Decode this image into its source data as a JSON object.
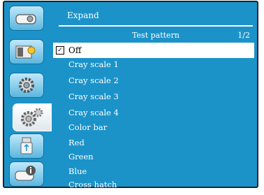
{
  "menu": {
    "title": "Expand",
    "subtitle": "Test pattern",
    "page": "1/2",
    "selected_check": "✓",
    "items": [
      {
        "label": "Off"
      },
      {
        "label": "Cray scale 1"
      },
      {
        "label": "Cray scale 2"
      },
      {
        "label": "Cray scale 3"
      },
      {
        "label": "Cray scale 4"
      },
      {
        "label": "Color bar"
      },
      {
        "label": "Red"
      },
      {
        "label": "Green"
      },
      {
        "label": "Blue"
      },
      {
        "label": "Cross hatch"
      }
    ]
  },
  "sidebar": [
    {
      "icon": "display-icon",
      "active": false
    },
    {
      "icon": "picture-adjust-icon",
      "active": false
    },
    {
      "icon": "gear-icon",
      "active": false
    },
    {
      "icon": "expand-gear-icon",
      "active": true
    },
    {
      "icon": "usb-icon",
      "active": false
    },
    {
      "icon": "info-icon",
      "active": false
    }
  ],
  "colors": {
    "background": "#1b93c9",
    "text": "#ffffff",
    "selected_bg": "#ffffff"
  }
}
